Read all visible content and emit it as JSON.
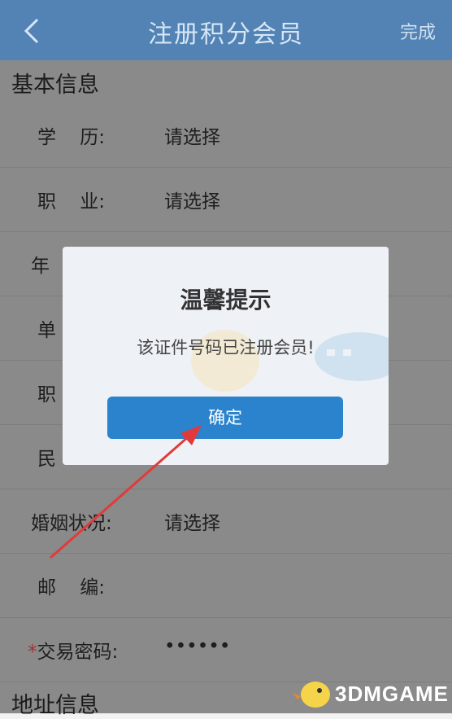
{
  "header": {
    "title": "注册积分会员",
    "done_label": "完成"
  },
  "sections": {
    "basic_title": "基本信息",
    "address_title": "地址信息"
  },
  "rows": [
    {
      "label": "学    历:",
      "value": "请选择"
    },
    {
      "label": "职    业:",
      "value": "请选择"
    },
    {
      "label": "年",
      "value": ""
    },
    {
      "label": "单",
      "value": ""
    },
    {
      "label": "职",
      "value": ""
    },
    {
      "label": "民",
      "value": ""
    },
    {
      "label": "婚姻状况:",
      "value": "请选择"
    },
    {
      "label": "邮    编:",
      "value": ""
    },
    {
      "label": "交易密码:",
      "value": "••••••",
      "required_mark": "*"
    }
  ],
  "dialog": {
    "title": "温馨提示",
    "message": "该证件号码已注册会员!",
    "confirm_label": "确定"
  },
  "watermark": {
    "brand": "3DMGAME"
  },
  "colors": {
    "header": "#5283b4",
    "dialog_button": "#2a83cc",
    "arrow": "#e23a3a"
  }
}
